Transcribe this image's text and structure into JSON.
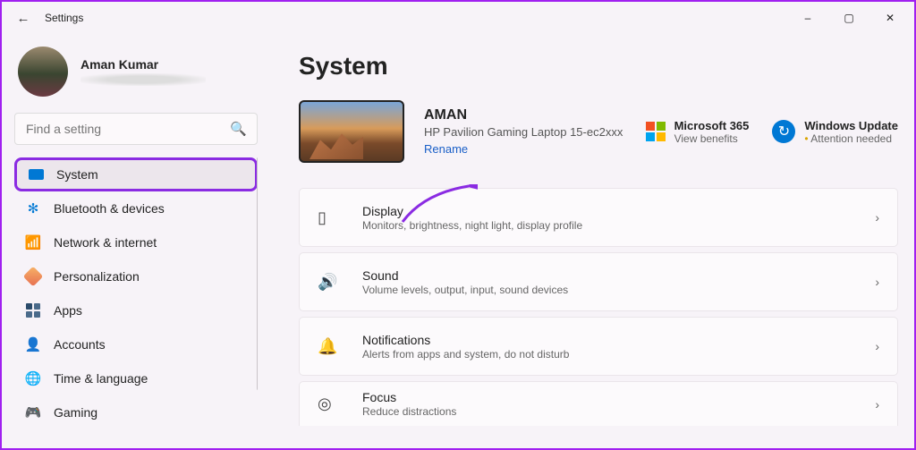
{
  "titlebar": {
    "title": "Settings"
  },
  "profile": {
    "name": "Aman Kumar"
  },
  "search": {
    "placeholder": "Find a setting"
  },
  "nav": [
    {
      "id": "system",
      "label": "System"
    },
    {
      "id": "bluetooth",
      "label": "Bluetooth & devices"
    },
    {
      "id": "network",
      "label": "Network & internet"
    },
    {
      "id": "personalization",
      "label": "Personalization"
    },
    {
      "id": "apps",
      "label": "Apps"
    },
    {
      "id": "accounts",
      "label": "Accounts"
    },
    {
      "id": "time",
      "label": "Time & language"
    },
    {
      "id": "gaming",
      "label": "Gaming"
    }
  ],
  "page": {
    "title": "System"
  },
  "device": {
    "name": "AMAN",
    "model": "HP Pavilion Gaming Laptop 15-ec2xxx",
    "rename": "Rename"
  },
  "status": {
    "ms365": {
      "title": "Microsoft 365",
      "sub": "View benefits"
    },
    "wu": {
      "title": "Windows Update",
      "sub": "Attention needed"
    }
  },
  "cards": [
    {
      "id": "display",
      "title": "Display",
      "sub": "Monitors, brightness, night light, display profile"
    },
    {
      "id": "sound",
      "title": "Sound",
      "sub": "Volume levels, output, input, sound devices"
    },
    {
      "id": "notifications",
      "title": "Notifications",
      "sub": "Alerts from apps and system, do not disturb"
    },
    {
      "id": "focus",
      "title": "Focus",
      "sub": "Reduce distractions"
    }
  ]
}
